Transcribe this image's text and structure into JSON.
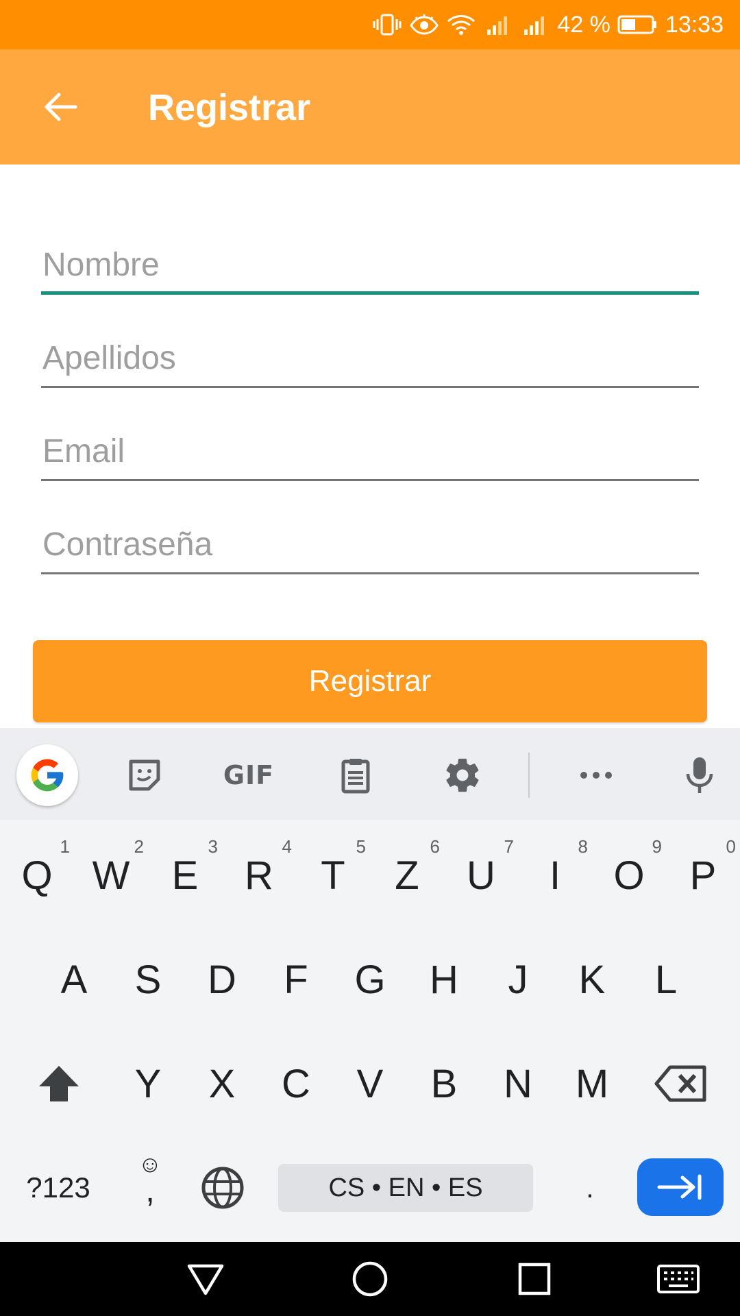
{
  "status_bar": {
    "battery_percent_text": "42 %",
    "time": "13:33",
    "icons": [
      "vibrate-icon",
      "eye-icon",
      "wifi-icon",
      "signal-icon",
      "signal-icon",
      "battery-icon"
    ]
  },
  "app_bar": {
    "title": "Registrar",
    "back_icon": "arrow-back-icon"
  },
  "form": {
    "name_placeholder": "Nombre",
    "surname_placeholder": "Apellidos",
    "email_placeholder": "Email",
    "password_placeholder": "Contraseña",
    "submit_label": "Registrar"
  },
  "keyboard": {
    "toolbar": [
      "google-icon",
      "sticker-icon",
      "gif-icon",
      "clipboard-icon",
      "gear-icon",
      "more-icon",
      "mic-icon"
    ],
    "gif_label": "GIF",
    "row1": [
      {
        "label": "Q",
        "hint": "1"
      },
      {
        "label": "W",
        "hint": "2"
      },
      {
        "label": "E",
        "hint": "3"
      },
      {
        "label": "R",
        "hint": "4"
      },
      {
        "label": "T",
        "hint": "5"
      },
      {
        "label": "Z",
        "hint": "6"
      },
      {
        "label": "U",
        "hint": "7"
      },
      {
        "label": "I",
        "hint": "8"
      },
      {
        "label": "O",
        "hint": "9"
      },
      {
        "label": "P",
        "hint": "0"
      }
    ],
    "row2": [
      "A",
      "S",
      "D",
      "F",
      "G",
      "H",
      "J",
      "K",
      "L"
    ],
    "row3": [
      "Y",
      "X",
      "C",
      "V",
      "B",
      "N",
      "M"
    ],
    "symbols_label": "?123",
    "comma_label": ",",
    "space_label": "CS • EN • ES",
    "period_label": ".",
    "colors": {
      "enter": "#1a73e8",
      "toolbar": "#eceef1",
      "keys_bg": "#f3f4f6"
    }
  },
  "colors": {
    "status_bar": "#ff8e00",
    "app_bar": "#ffa83f",
    "button": "#ff9a20",
    "focus_underline": "#13907f"
  },
  "nav_bar": {
    "buttons": [
      "back-triangle-icon",
      "home-circle-icon",
      "recents-square-icon",
      "keyboard-icon"
    ]
  }
}
